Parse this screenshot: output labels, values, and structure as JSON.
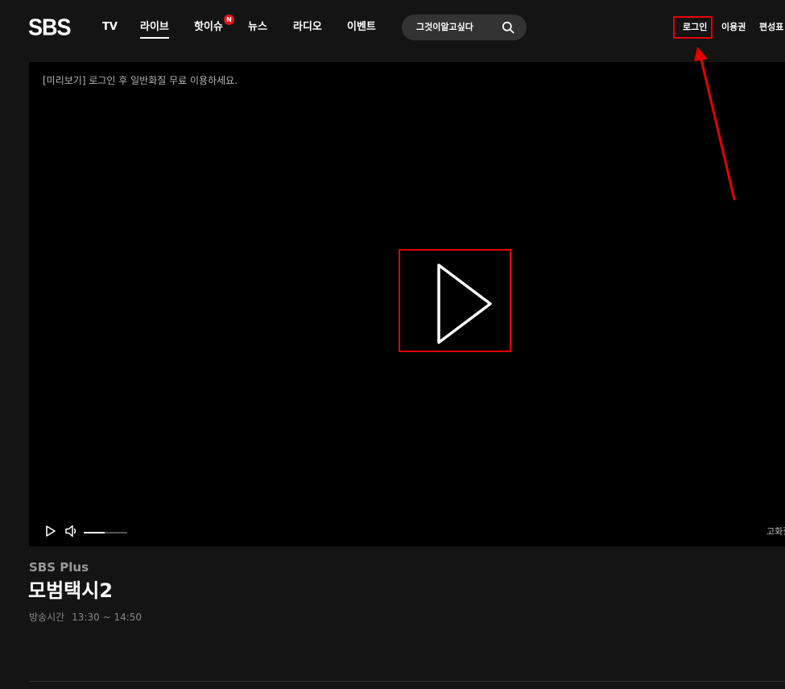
{
  "header": {
    "logo": "SBS",
    "nav": [
      {
        "label": "TV"
      },
      {
        "label": "라이브",
        "active": true
      },
      {
        "label": "핫이슈",
        "badge": "N"
      },
      {
        "label": "뉴스"
      },
      {
        "label": "라디오"
      },
      {
        "label": "이벤트"
      }
    ],
    "search": {
      "text": "그것이알고싶다",
      "icon": "search-icon"
    },
    "util": [
      {
        "label": "로그인"
      },
      {
        "label": "이용권"
      },
      {
        "label": "편성표"
      }
    ]
  },
  "player": {
    "notice": "[미리보기] 로그인 후 일반화질 무료 이용하세요.",
    "quality_label": "고화질",
    "volume_level": 0.48
  },
  "program": {
    "channel": "SBS Plus",
    "title": "모범택시2",
    "airtime_label": "방송시간",
    "airtime": "13:30 ~ 14:50"
  },
  "colors": {
    "background": "#141414",
    "player_bg": "#000000",
    "badge": "#e5151d",
    "annotation": "#e60000"
  }
}
